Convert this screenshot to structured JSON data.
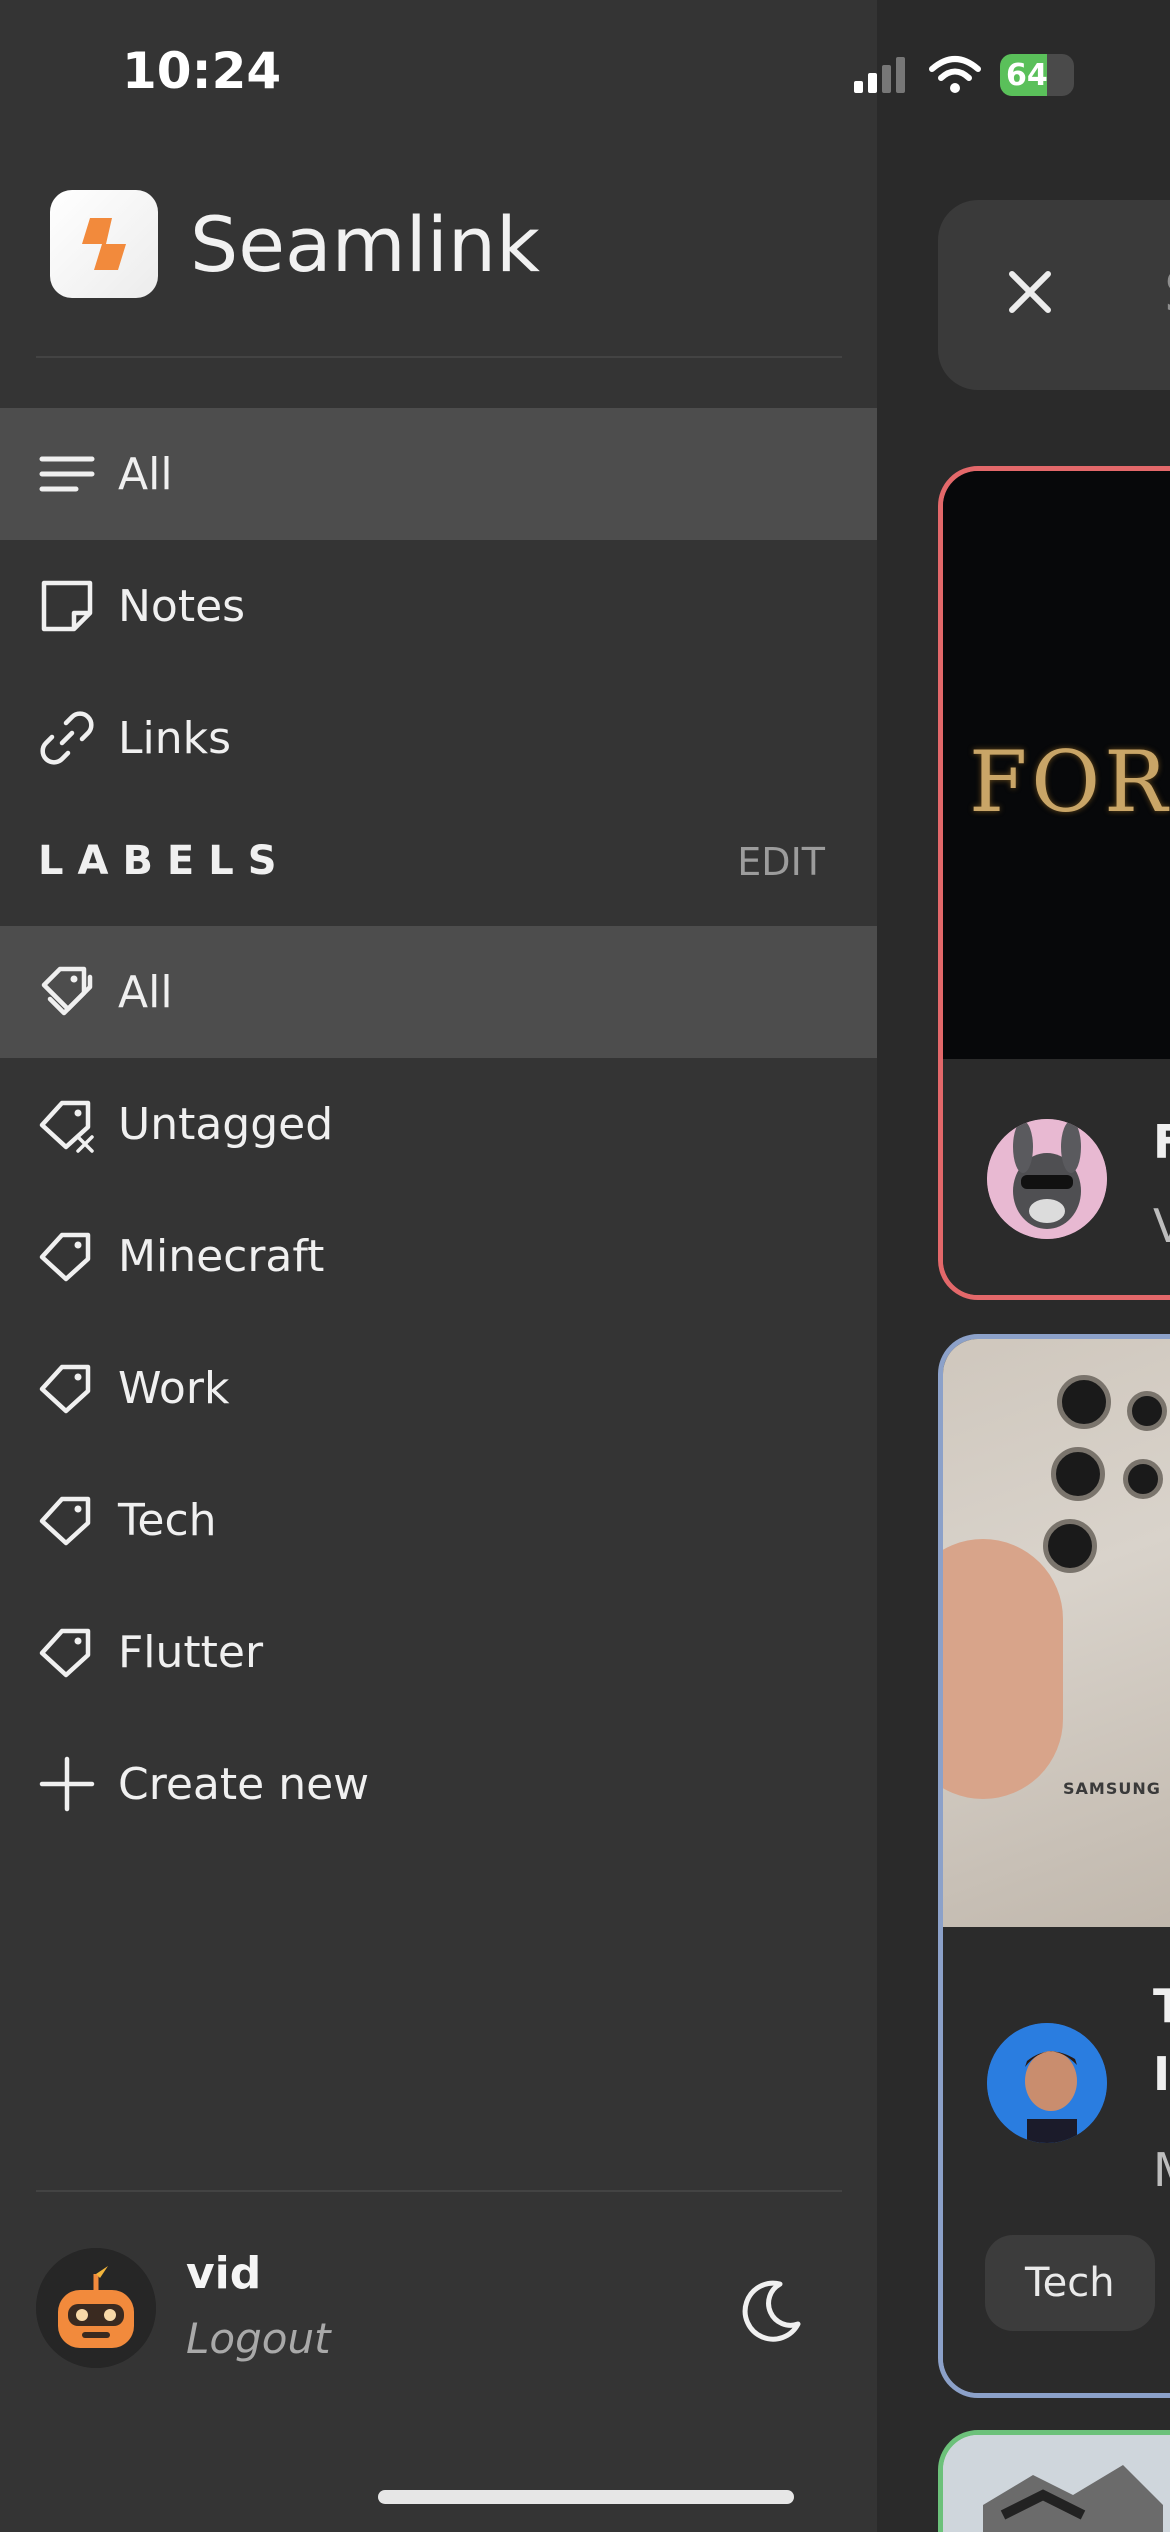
{
  "status_bar": {
    "time": "10:24",
    "battery": "64",
    "battery_level": 0.64
  },
  "app": {
    "name": "Seamlink"
  },
  "nav": {
    "items": [
      {
        "label": "All",
        "icon": "list-icon",
        "active": true
      },
      {
        "label": "Notes",
        "icon": "note-icon",
        "active": false
      },
      {
        "label": "Links",
        "icon": "link-icon",
        "active": false
      }
    ]
  },
  "labels": {
    "header": "LABELS",
    "edit_label": "EDIT",
    "items": [
      {
        "label": "All",
        "icon": "tags-icon",
        "active": true
      },
      {
        "label": "Untagged",
        "icon": "tag-off-icon",
        "active": false
      },
      {
        "label": "Minecraft",
        "icon": "tag-icon",
        "active": false
      },
      {
        "label": "Work",
        "icon": "tag-icon",
        "active": false
      },
      {
        "label": "Tech",
        "icon": "tag-icon",
        "active": false
      },
      {
        "label": "Flutter",
        "icon": "tag-icon",
        "active": false
      }
    ],
    "create_label": "Create new"
  },
  "user": {
    "name": "vid",
    "logout_label": "Logout"
  },
  "main": {
    "search_placeholder": "Se",
    "cards": [
      {
        "thumbnail_title": "FORS",
        "title_initial": "F",
        "subtitle_initial": "V",
        "border_color": "#e3686a"
      },
      {
        "thumbnail_brand": "SAMSUNG",
        "title_initial": "T",
        "line2_initial": "I",
        "line3_initial": "M",
        "tag": "Tech",
        "border_color": "#8ca1c9"
      },
      {
        "border_color": "#6cc17a"
      }
    ]
  },
  "colors": {
    "drawer_bg": "#343434",
    "active_bg": "#4d4d4d",
    "accent": "#f28a3c"
  }
}
